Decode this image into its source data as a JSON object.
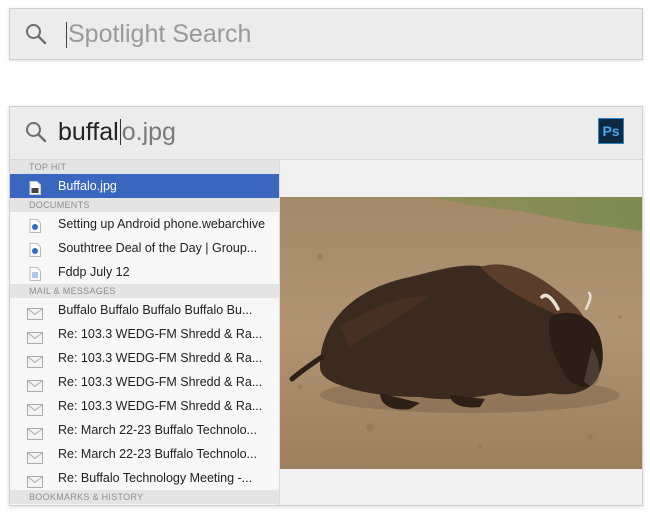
{
  "spotlight": {
    "placeholder": "Spotlight Search"
  },
  "query": {
    "typed": "buffal",
    "completion": "o.jpg"
  },
  "app_icon": {
    "label": "Ps",
    "name": "photoshop-icon"
  },
  "sections": {
    "top_hit": "TOP HIT",
    "documents": "DOCUMENTS",
    "mail": "MAIL & MESSAGES",
    "bookmarks": "BOOKMARKS & HISTORY"
  },
  "top_hit": {
    "label": "Buffalo.jpg",
    "icon": "image-file-icon"
  },
  "documents": [
    {
      "label": "Setting up Android phone.webarchive",
      "icon": "webarchive-icon"
    },
    {
      "label": "Southtree Deal of the Day | Group...",
      "icon": "webarchive-icon"
    },
    {
      "label": "Fddp July 12",
      "icon": "document-icon"
    }
  ],
  "mail": [
    {
      "label": "Buffalo Buffalo Buffalo Buffalo Bu..."
    },
    {
      "label": "Re: 103.3 WEDG-FM Shredd & Ra..."
    },
    {
      "label": "Re: 103.3 WEDG-FM Shredd & Ra..."
    },
    {
      "label": "Re: 103.3 WEDG-FM Shredd & Ra..."
    },
    {
      "label": "Re: 103.3 WEDG-FM Shredd & Ra..."
    },
    {
      "label": "Re: March 22-23 Buffalo Technolo..."
    },
    {
      "label": "Re: March 22-23 Buffalo Technolo..."
    },
    {
      "label": "Re: Buffalo Technology Meeting -..."
    }
  ],
  "colors": {
    "selection": "#3b66c0",
    "photoshop_bg": "#0e2a43",
    "photoshop_text": "#46a8ee"
  }
}
